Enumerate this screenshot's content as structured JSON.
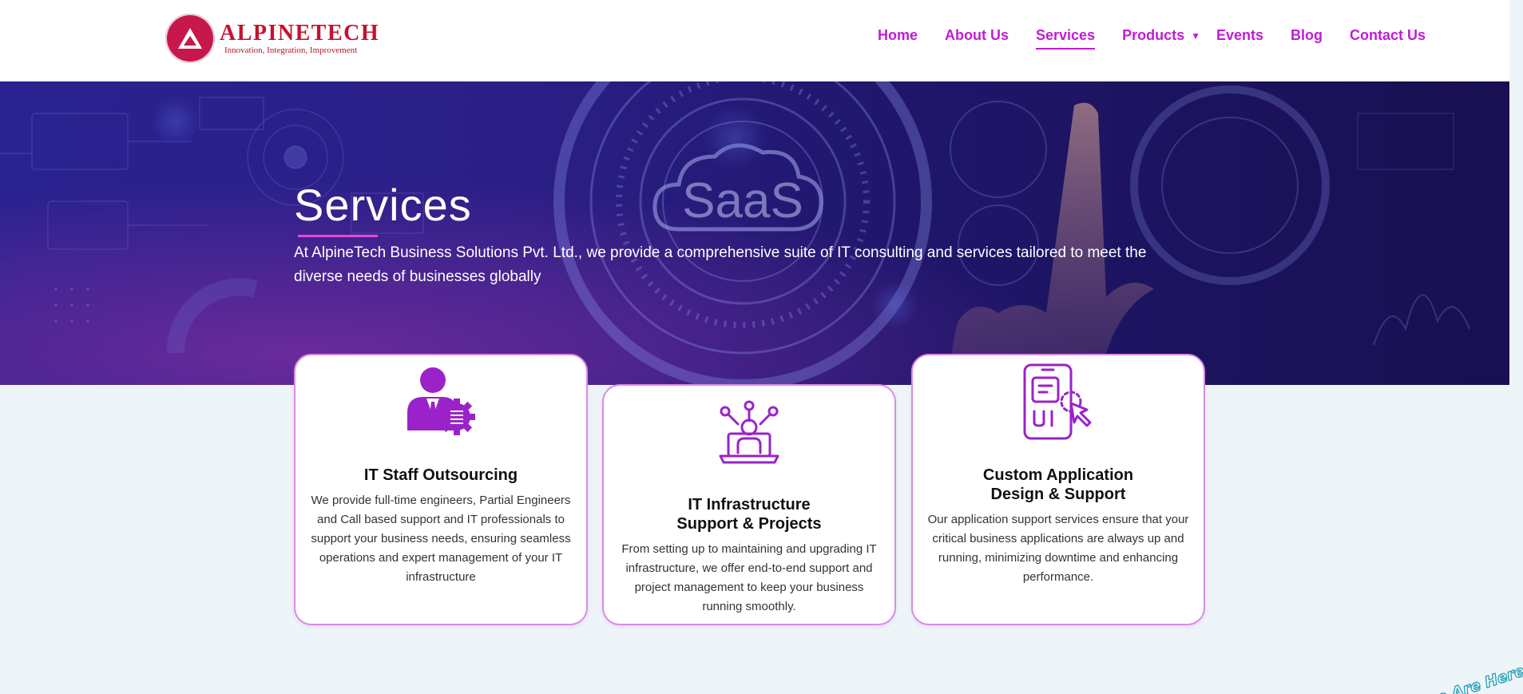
{
  "brand": {
    "name": "ALPINETECH",
    "tagline": "Innovation, Integration, Improvement",
    "color": "#c8102e"
  },
  "nav": {
    "items": [
      {
        "label": "Home",
        "active": false
      },
      {
        "label": "About Us",
        "active": false
      },
      {
        "label": "Services",
        "active": true
      },
      {
        "label": "Products",
        "active": false,
        "has_dropdown": true
      },
      {
        "label": "Events",
        "active": false
      },
      {
        "label": "Blog",
        "active": false
      },
      {
        "label": "Contact Us",
        "active": false
      }
    ],
    "color": "#c21bd8"
  },
  "hero": {
    "title": "Services",
    "description": "At AlpineTech Business Solutions Pvt. Ltd., we provide a comprehensive suite of IT consulting and services tailored to meet the diverse needs of businesses globally",
    "background_text": "SaaS"
  },
  "cards": [
    {
      "icon": "staff-gear-icon",
      "title_line1": "IT Staff Outsourcing",
      "title_line2": "",
      "description": "We provide full-time engineers, Partial Engineers and Call based support and IT professionals to support your business needs, ensuring seamless operations and expert management of your IT infrastructure"
    },
    {
      "icon": "laptop-network-icon",
      "title_line1": "IT Infrastructure",
      "title_line2": "Support & Projects",
      "description": "From setting up to maintaining and upgrading IT infrastructure, we offer end-to-end support and project management to keep your business running smoothly."
    },
    {
      "icon": "mobile-ui-icon",
      "title_line1": "Custom Application",
      "title_line2": "Design & Support",
      "description": "Our application support services ensure that your critical business applications are always up and running, minimizing downtime and enhancing performance."
    }
  ],
  "badge": {
    "text": "e Are Here!"
  },
  "colors": {
    "accent": "#c21bd8",
    "icon": "#9b22c8",
    "card_border": "#d98ae6",
    "page_bg": "#eef5f9"
  }
}
